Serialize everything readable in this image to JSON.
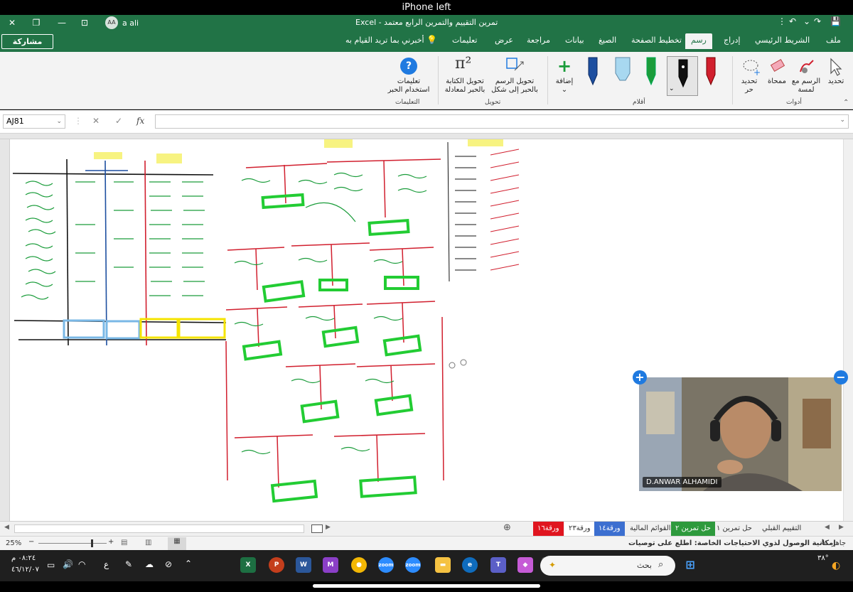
{
  "device": {
    "status_title": "iPhone left"
  },
  "titlebar": {
    "doc_title": "تمرين التقييم والتمرين الرابع معتمد  -  Excel",
    "user_initials": "AA",
    "user_name": "a ali"
  },
  "tabs": {
    "file": "ملف",
    "home": "الشريط الرئيسي",
    "insert": "إدراج",
    "draw": "رسم",
    "page_layout": "تخطيط الصفحة",
    "formulas": "الصيغ",
    "data": "بيانات",
    "review": "مراجعة",
    "view": "عرض",
    "help": "تعليمات",
    "tell_me": "أخبرني بما تريد القيام به",
    "share": "مشاركة"
  },
  "ribbon": {
    "tools_group": "أدوات",
    "select": "تحديد",
    "draw_with_touch": "الرسم مع لمسة",
    "eraser": "ممحاة",
    "lasso": "تحديد حر",
    "pens_group": "أقلام",
    "add_pen": "إضافة",
    "convert_group": "تحويل",
    "ink_to_shape": "تحويل الرسم بالحبر إلى شكل",
    "ink_to_math": "تحويل الكتابة بالحبر لمعادلة",
    "help_group": "التعليمات",
    "ink_help": "تعليمات استخدام الحبر",
    "pen_colors": [
      "#d11f2e",
      "#111111",
      "#1a9c3a",
      "#a8d8f0",
      "#1d4fa0"
    ]
  },
  "formula_bar": {
    "name_box": "AJ81",
    "fx": "fx",
    "content": ""
  },
  "video": {
    "participant": "D.ANWAR ALHAMIDI"
  },
  "sheet_tabs": [
    "التقييم القبلي",
    "حل تمرين ١",
    "حل تمرين ٢",
    "القوائم المالية",
    "ورقة١٤",
    "ورقة٢٣",
    "ورقة١٦"
  ],
  "status": {
    "ready": "جاهز",
    "accessibility": "إمكانية الوصول لذوي الاحتياجات الخاصة: اطلع على توصيات",
    "zoom": "25%"
  },
  "taskbar": {
    "search_placeholder": "بحث",
    "time": "٠٨:٢٤ م",
    "date": "٤٦/١٢/٠٧",
    "lang": "ع",
    "temp": "٣٨°"
  }
}
